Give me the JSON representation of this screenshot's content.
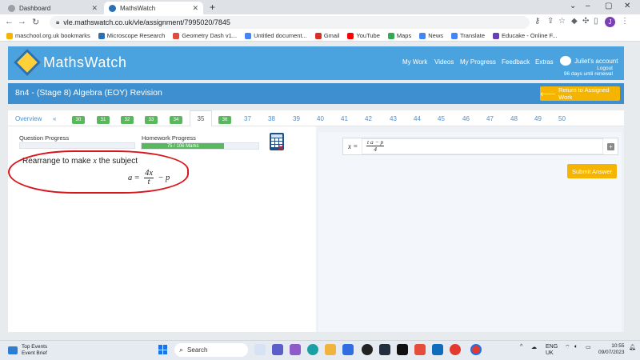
{
  "browser": {
    "tabs": [
      {
        "label": "Dashboard",
        "color": "#5f6368"
      },
      {
        "label": "MathsWatch",
        "color": "#2b6fb4"
      }
    ],
    "new_tab": "+",
    "url": "vle.mathswatch.co.uk/vle/assignment/7995020/7845",
    "bookmarks": [
      {
        "label": "maschool.org.uk bookmarks",
        "color": "#f4b400"
      },
      {
        "label": "Microscope Research",
        "color": "#2b6fb4"
      },
      {
        "label": "Geometry Dash v1...",
        "color": "#e04a3f"
      },
      {
        "label": "Untitled document...",
        "color": "#4285f4"
      },
      {
        "label": "Gmail",
        "color": "#d93025"
      },
      {
        "label": "YouTube",
        "color": "#ff0000"
      },
      {
        "label": "Maps",
        "color": "#34a853"
      },
      {
        "label": "News",
        "color": "#4285f4"
      },
      {
        "label": "Translate",
        "color": "#4285f4"
      },
      {
        "label": "Educake - Online F...",
        "color": "#6a3fb5"
      }
    ]
  },
  "site": {
    "brand": "MathsWatch",
    "nav": [
      "My Work",
      "Videos",
      "My Progress",
      "Feedback",
      "Extras"
    ],
    "account_name": "Juliet's account",
    "logout": "Logout",
    "renewal": "96 days until renewal"
  },
  "assignment": {
    "title": "8n4 - (Stage 8) Algebra (EOY) Revision",
    "return_button": "Return to Assigned Work"
  },
  "question_nav": {
    "overview": "Overview",
    "prev": "«",
    "done": [
      "30",
      "31",
      "32",
      "33",
      "34"
    ],
    "current": "35",
    "after_current_done": "36",
    "pending": [
      "37",
      "38",
      "39",
      "40",
      "41",
      "42",
      "43",
      "44",
      "45",
      "46",
      "47",
      "48",
      "49",
      "50"
    ]
  },
  "progress": {
    "question_label": "Question Progress",
    "homework_label": "Homework Progress",
    "homework_marks": "75 / 106 Marks",
    "homework_fraction": 0.708
  },
  "question": {
    "instruction_pre": "Rearrange to make ",
    "instruction_var": "x",
    "instruction_post": " the subject",
    "lhs": "a",
    "equals": "=",
    "numerator": "4x",
    "denominator": "t",
    "minus": "−",
    "tail": "p"
  },
  "answer": {
    "label": "x =",
    "numerator": "t a − p",
    "denominator": "4",
    "plus": "+",
    "submit": "Submit Answer"
  },
  "taskbar": {
    "weather_title": "Top Events",
    "weather_sub": "Event Brief",
    "search_placeholder": "Search",
    "lang1": "ENG",
    "lang2": "UK",
    "time": "10:55",
    "date": "09/07/2023"
  }
}
